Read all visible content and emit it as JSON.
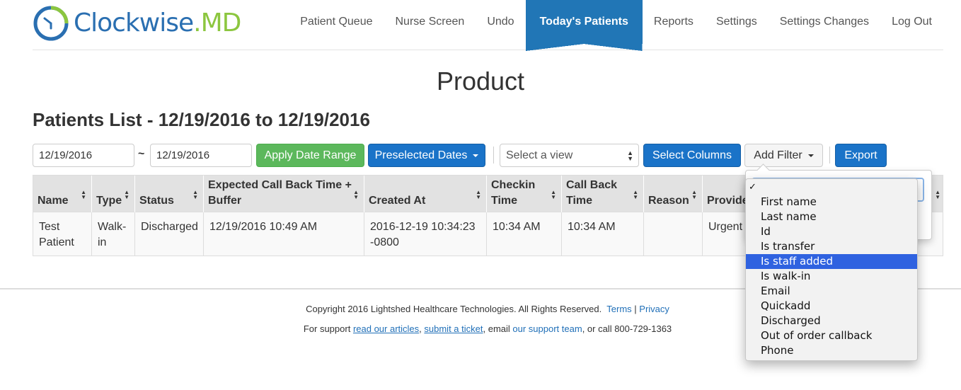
{
  "brand": {
    "name_part1": "Clockwise",
    "name_part2": ".MD"
  },
  "nav": {
    "items": [
      {
        "label": "Patient Queue"
      },
      {
        "label": "Nurse Screen"
      },
      {
        "label": "Undo"
      },
      {
        "label": "Today's Patients"
      },
      {
        "label": "Reports"
      },
      {
        "label": "Settings"
      },
      {
        "label": "Settings Changes"
      },
      {
        "label": "Log Out"
      }
    ],
    "active": "Today's Patients"
  },
  "page_title": "Product",
  "list_title": "Patients List - 12/19/2016 to 12/19/2016",
  "toolbar": {
    "start_date": "12/19/2016",
    "separator": "~",
    "end_date": "12/19/2016",
    "apply_label": "Apply Date Range",
    "preselected_label": "Preselected Dates",
    "view_placeholder": "Select a view",
    "columns_label": "Select Columns",
    "add_filter_label": "Add Filter",
    "export_label": "Export"
  },
  "table": {
    "columns": [
      {
        "line1": "Name",
        "line2": ""
      },
      {
        "line1": "Type",
        "line2": ""
      },
      {
        "line1": "Status",
        "line2": ""
      },
      {
        "line1": "Expected Call Back Time +",
        "line2": "Buffer"
      },
      {
        "line1": "Created At",
        "line2": ""
      },
      {
        "line1": "Checkin",
        "line2": "Time"
      },
      {
        "line1": "Call Back",
        "line2": "Time"
      },
      {
        "line1": "Reason",
        "line2": ""
      },
      {
        "line1": "Provide",
        "line2": ""
      }
    ],
    "rows": [
      {
        "name": [
          "Test",
          "Patient"
        ],
        "type": [
          "Walk-",
          "in"
        ],
        "status": "Discharged",
        "expected": "12/19/2016 10:49 AM",
        "created": [
          "2016-12-19 10:34:23",
          "-0800"
        ],
        "checkin": "10:34 AM",
        "callback": "10:34 AM",
        "reason": "",
        "provider": "Urgent"
      }
    ]
  },
  "filter_dropdown": {
    "check_mark": "✓",
    "options": [
      {
        "label": ""
      },
      {
        "label": "First name"
      },
      {
        "label": "Last name"
      },
      {
        "label": "Id"
      },
      {
        "label": "Is transfer"
      },
      {
        "label": "Is staff added"
      },
      {
        "label": "Is walk-in"
      },
      {
        "label": "Email"
      },
      {
        "label": "Quickadd"
      },
      {
        "label": "Discharged"
      },
      {
        "label": "Out of order callback"
      },
      {
        "label": "Phone"
      }
    ],
    "highlighted": "Is staff added"
  },
  "footer": {
    "copyright": "Copyright 2016 Lightshed Healthcare Technologies. All Rights Reserved.",
    "terms": "Terms",
    "divider": "|",
    "privacy": "Privacy",
    "support_prefix": "For support",
    "articles_link": "read our articles",
    "ticket_link": "submit a ticket",
    "email_text": ", email",
    "team_link": "our support team",
    "call_text": ", or call 800-729-1363"
  },
  "colors": {
    "brand_blue": "#2a6fb1",
    "brand_green": "#8cc63f",
    "nav_active": "#2176b6",
    "button_blue": "#1a73c8",
    "button_green": "#5cb85c",
    "menu_highlight": "#2f62e0"
  }
}
